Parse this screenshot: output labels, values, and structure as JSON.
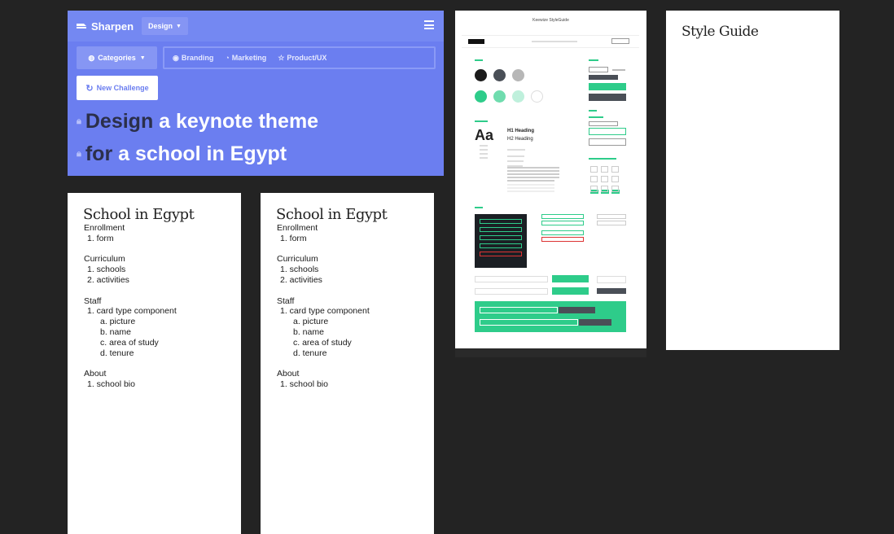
{
  "sharpen": {
    "brand": "Sharpen",
    "design_dropdown": "Design",
    "categories_label": "Categories",
    "tabs": [
      "Branding",
      "Marketing",
      "Product/UX"
    ],
    "new_challenge_label": "New Challenge",
    "line1": {
      "keyword": "Design",
      "text": "a keynote theme"
    },
    "line2": {
      "keyword": "for",
      "text": "a school in Egypt"
    },
    "colors": {
      "accent": "#6b7ef0",
      "keyword": "#2b2f4a"
    }
  },
  "school_cards": [
    {
      "title": "School in Egypt",
      "sections": [
        {
          "heading": "Enrollment",
          "items": [
            "1. form"
          ]
        },
        {
          "heading": "Curriculum",
          "items": [
            "1. schools",
            "2. activities"
          ]
        },
        {
          "heading": "Staff",
          "items": [
            "1. card type component"
          ],
          "subitems": [
            "a. picture",
            "b. name",
            "c. area of study",
            "d. tenure"
          ]
        },
        {
          "heading": "About",
          "items": [
            "1. school bio"
          ]
        }
      ]
    },
    {
      "title": "School in Egypt",
      "sections": [
        {
          "heading": "Enrollment",
          "items": [
            "1. form"
          ]
        },
        {
          "heading": "Curriculum",
          "items": [
            "1. schools",
            "2. activities"
          ]
        },
        {
          "heading": "Staff",
          "items": [
            "1. card type component"
          ],
          "subitems": [
            "a. picture",
            "b. name",
            "c. area of study",
            "d. tenure"
          ]
        },
        {
          "heading": "About",
          "items": [
            "1. school bio"
          ]
        }
      ]
    }
  ],
  "style_guide_preview": {
    "title": "Keewize StyleGuide",
    "swatches": [
      "#1b1b1b",
      "#4a4f57",
      "#b7b7b7",
      "#2ecc8a",
      "#6fdcae",
      "#bff0dc",
      "#ffffff"
    ],
    "heading_sample": "Aa",
    "h1": "H1 Heading",
    "h2": "H2 Heading"
  },
  "style_guide": {
    "title": "Style Guide"
  }
}
